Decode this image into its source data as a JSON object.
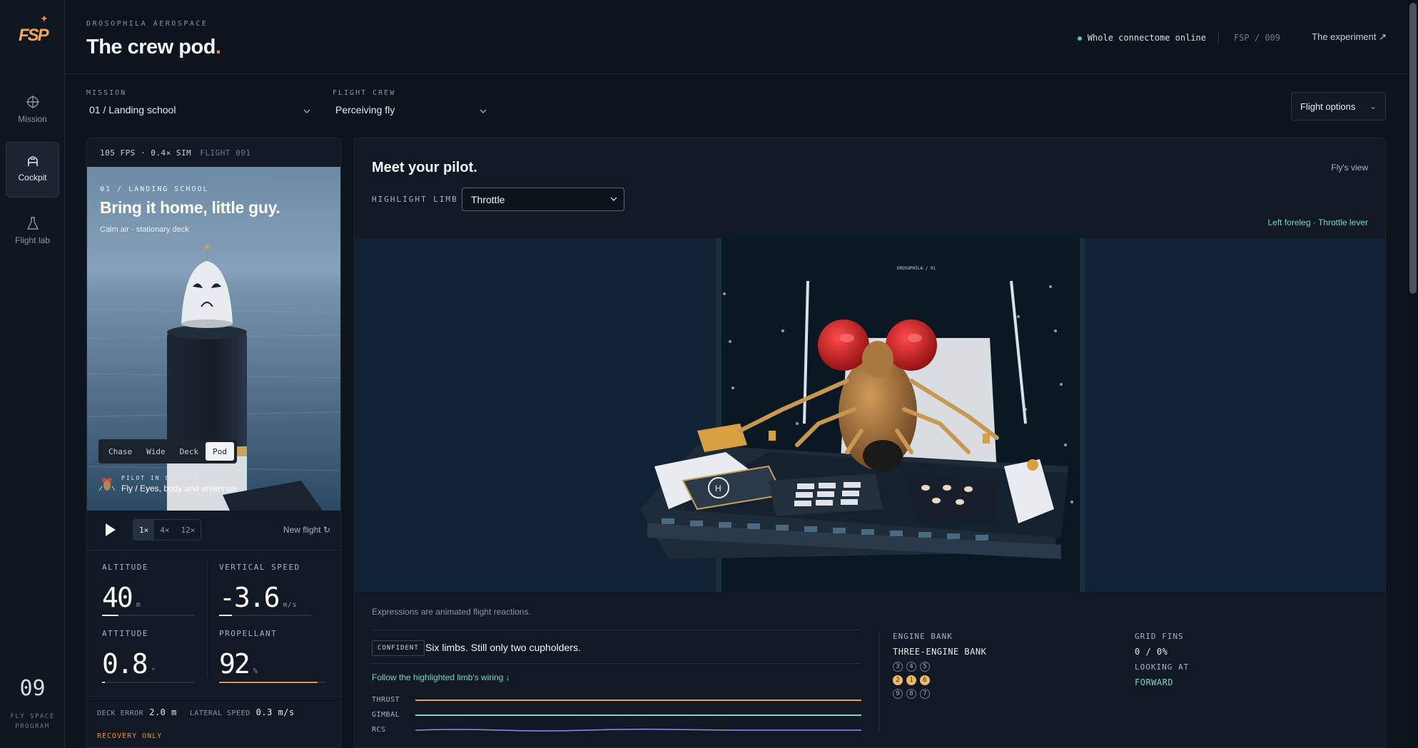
{
  "brand": {
    "logo_text": "FSP",
    "program_num": "09",
    "program_name": "FLY SPACE PROGRAM"
  },
  "nav": [
    {
      "label": "Mission",
      "icon": "crosshair-icon",
      "active": false
    },
    {
      "label": "Cockpit",
      "icon": "cockpit-seat-icon",
      "active": true
    },
    {
      "label": "Flight lab",
      "icon": "flask-icon",
      "active": false
    }
  ],
  "header": {
    "eyebrow": "DROSOPHILA AEROSPACE",
    "title": "The crew pod",
    "title_dot": ".",
    "status": "Whole connectome online",
    "code": "FSP / 009",
    "link": "The experiment ↗"
  },
  "selectors": {
    "mission_label": "MISSION",
    "mission_value": "01 / Landing school",
    "crew_label": "FLIGHT CREW",
    "crew_value": "Perceiving fly",
    "options_label": "Flight options",
    "options_chevron": "⌄"
  },
  "sim": {
    "fps": "105 FPS · 0.4× SIM",
    "flight": "FLIGHT 001",
    "scene_eyebrow": "01 / LANDING SCHOOL",
    "scene_title": "Bring it home, little guy.",
    "scene_sub": "Calm air · stationary deck",
    "cameras": [
      "Chase",
      "Wide",
      "Deck",
      "Pod"
    ],
    "active_camera": "Pod",
    "pilot_label": "PILOT IN COMMAND",
    "pilot_name": "Fly / Eyes, body and antennae",
    "speeds": [
      "1×",
      "4×",
      "12×"
    ],
    "active_speed": "1×",
    "new_flight": "New flight ↻"
  },
  "telemetry": {
    "altitude": {
      "label": "ALTITUDE",
      "value": "40",
      "unit": "m",
      "level": 0.18
    },
    "vspeed": {
      "label": "VERTICAL SPEED",
      "value": "-3.6",
      "unit": "m/s",
      "level": 0.14
    },
    "attitude": {
      "label": "ATTITUDE",
      "value": "0.8",
      "unit": "°",
      "level": 0.03
    },
    "propellant": {
      "label": "PROPELLANT",
      "value": "92",
      "unit": "%",
      "level": 0.92
    },
    "deck_error_label": "DECK ERROR",
    "deck_error": "2.0 m",
    "lateral_label": "LATERAL SPEED",
    "lateral": "0.3 m/s",
    "recovery": "RECOVERY ONLY"
  },
  "pilot_panel": {
    "title": "Meet your pilot.",
    "view_label": "Fly's view",
    "highlight_label": "HIGHLIGHT LIMB",
    "highlight_value": "Throttle",
    "highlight_note": "Left foreleg · Throttle lever",
    "console_tag": "DROSOPHILA / 01",
    "expressions_note": "Expressions are animated flight reactions.",
    "confidence_badge": "CONFIDENT",
    "confidence_text": "Six limbs. Still only two cupholders.",
    "wiring_link": "Follow the highlighted limb's wiring ↓",
    "traces": [
      "THRUST",
      "GIMBAL",
      "RCS"
    ],
    "trace_colors": [
      "#f0a050",
      "#7fd4c1",
      "#8f8cf0"
    ]
  },
  "engines": {
    "label": "ENGINE BANK",
    "value": "THREE-ENGINE BANK",
    "rows": [
      [
        {
          "n": "3",
          "on": false
        },
        {
          "n": "4",
          "on": false
        },
        {
          "n": "5",
          "on": false
        }
      ],
      [
        {
          "n": "2",
          "on": true
        },
        {
          "n": "1",
          "on": true
        },
        {
          "n": "6",
          "on": true
        }
      ],
      [
        {
          "n": "9",
          "on": false
        },
        {
          "n": "8",
          "on": false
        },
        {
          "n": "7",
          "on": false
        }
      ]
    ]
  },
  "fins": {
    "label": "GRID FINS",
    "value": "0 / 0%",
    "look_label": "LOOKING AT",
    "look_value": "FORWARD"
  },
  "colors": {
    "accent": "#f08a3a",
    "teal": "#7fd4c1",
    "bg": "#0d141d"
  }
}
